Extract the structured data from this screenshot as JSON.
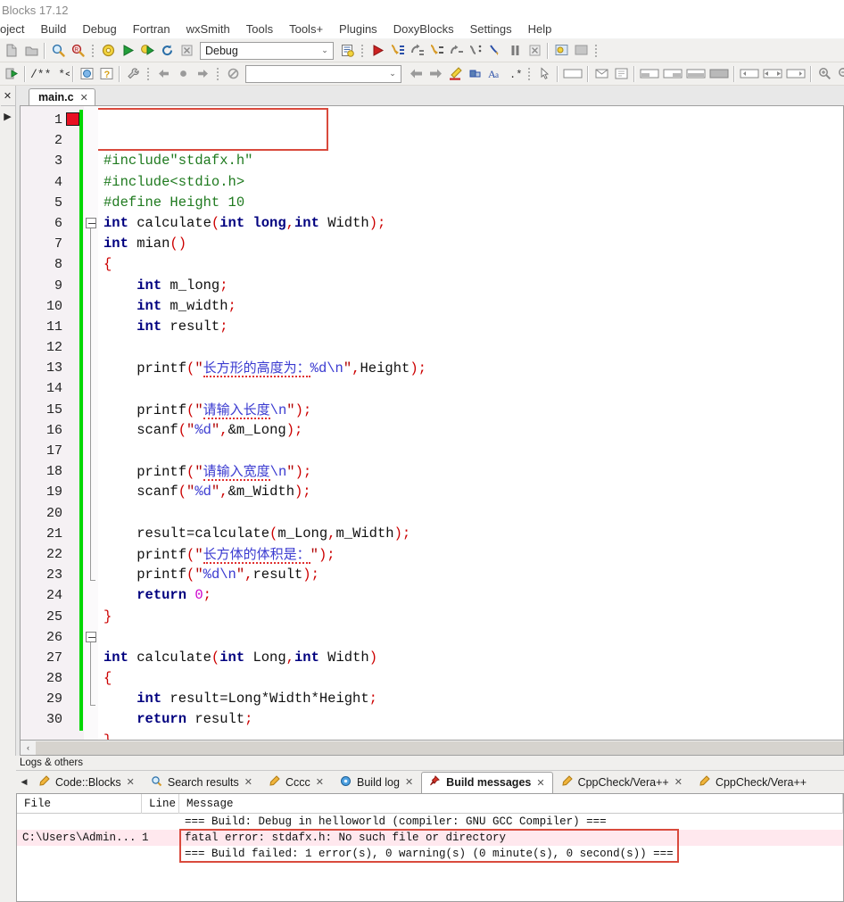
{
  "window": {
    "title": "Blocks 17.12"
  },
  "menubar": {
    "items": [
      {
        "label": "oject"
      },
      {
        "label": "Build"
      },
      {
        "label": "Debug"
      },
      {
        "label": "Fortran"
      },
      {
        "label": "wxSmith"
      },
      {
        "label": "Tools"
      },
      {
        "label": "Tools+"
      },
      {
        "label": "Plugins"
      },
      {
        "label": "DoxyBlocks"
      },
      {
        "label": "Settings"
      },
      {
        "label": "Help"
      }
    ]
  },
  "toolbar_main": {
    "target_combo": {
      "value": "Debug",
      "arrow": "⌄"
    },
    "icons": [
      "new-file-icon",
      "open-file-icon",
      "find-icon",
      "find-replace-icon",
      "build-icon",
      "run-icon",
      "build-and-run-icon",
      "rebuild-icon",
      "abort-build-icon",
      "build-target-options-icon",
      "debug-continue-icon",
      "debug-run-to-cursor-icon",
      "debug-next-line-icon",
      "debug-step-into-icon",
      "debug-step-out-icon",
      "debug-next-instruction-icon",
      "debug-step-into-instruction-icon",
      "debug-break-icon",
      "debug-stop-icon",
      "debugging-windows-icon",
      "various-info-icon"
    ]
  },
  "toolbar_secondary": {
    "blank_combo": {
      "value": "",
      "arrow": "⌄"
    },
    "icons": [
      "doxyblocks-run-icon",
      "doxyblocks-comment-icon",
      "doxyblocks-block-comment-icon",
      "doxyblocks-preview-icon",
      "doxyblocks-help-icon",
      "doxyblocks-config-icon",
      "goto-previous-icon",
      "bookmark-icon",
      "goto-next-icon",
      "clear-bookmarks-icon",
      "back-icon",
      "forward-icon",
      "highlight-icon",
      "replace-icon",
      "font-size-icon",
      "regex-icon",
      "pointer-icon",
      "panel-icon",
      "envelope-icon",
      "form-icon",
      "align-left-icon",
      "align-right-icon",
      "align-center-icon",
      "fill-icon",
      "expand-left-icon",
      "shrink-icon",
      "expand-right-icon",
      "zoom-in-icon",
      "zoom-out-icon"
    ]
  },
  "left_dock": {
    "close_label": "✕",
    "expand_label": "▶"
  },
  "editor": {
    "tab": {
      "label": "main.c",
      "close": "✕"
    },
    "breakpoint_line": 1,
    "fold_open_lines": [
      6,
      26
    ],
    "annotation_rect": {
      "note": "red box around include lines"
    },
    "hscroll": {
      "left_arrow": "‹"
    },
    "lines": [
      {
        "n": 1,
        "tokens": [
          {
            "t": "pre",
            "v": "#include\"stdafx.h\""
          }
        ]
      },
      {
        "n": 2,
        "tokens": [
          {
            "t": "pre",
            "v": "#include<stdio.h>"
          }
        ]
      },
      {
        "n": 3,
        "tokens": [
          {
            "t": "pre",
            "v": "#define Height 10"
          }
        ]
      },
      {
        "n": 4,
        "tokens": [
          {
            "t": "kw",
            "v": "int"
          },
          {
            "t": "id",
            "v": " calculate"
          },
          {
            "t": "pun",
            "v": "("
          },
          {
            "t": "kw",
            "v": "int"
          },
          {
            "t": "id",
            "v": " "
          },
          {
            "t": "kw",
            "v": "long"
          },
          {
            "t": "pun",
            "v": ","
          },
          {
            "t": "kw",
            "v": "int"
          },
          {
            "t": "id",
            "v": " Width"
          },
          {
            "t": "pun",
            "v": ");"
          }
        ]
      },
      {
        "n": 5,
        "tokens": [
          {
            "t": "kw",
            "v": "int"
          },
          {
            "t": "id",
            "v": " mian"
          },
          {
            "t": "pun",
            "v": "()"
          }
        ]
      },
      {
        "n": 6,
        "tokens": [
          {
            "t": "pun",
            "v": "{"
          }
        ]
      },
      {
        "n": 7,
        "tokens": [
          {
            "t": "id",
            "v": "    "
          },
          {
            "t": "kw",
            "v": "int"
          },
          {
            "t": "id",
            "v": " m_long"
          },
          {
            "t": "pun",
            "v": ";"
          }
        ]
      },
      {
        "n": 8,
        "tokens": [
          {
            "t": "id",
            "v": "    "
          },
          {
            "t": "kw",
            "v": "int"
          },
          {
            "t": "id",
            "v": " m_width"
          },
          {
            "t": "pun",
            "v": ";"
          }
        ]
      },
      {
        "n": 9,
        "tokens": [
          {
            "t": "id",
            "v": "    "
          },
          {
            "t": "kw",
            "v": "int"
          },
          {
            "t": "id",
            "v": " result"
          },
          {
            "t": "pun",
            "v": ";"
          }
        ]
      },
      {
        "n": 10,
        "tokens": []
      },
      {
        "n": 11,
        "tokens": [
          {
            "t": "id",
            "v": "    printf"
          },
          {
            "t": "pun",
            "v": "("
          },
          {
            "t": "qt",
            "v": "\""
          },
          {
            "t": "cjk",
            "v": "长方形的高度为："
          },
          {
            "t": "str",
            "v": "%d\\n"
          },
          {
            "t": "qt",
            "v": "\""
          },
          {
            "t": "pun",
            "v": ","
          },
          {
            "t": "id",
            "v": "Height"
          },
          {
            "t": "pun",
            "v": ");"
          }
        ]
      },
      {
        "n": 12,
        "tokens": []
      },
      {
        "n": 13,
        "tokens": [
          {
            "t": "id",
            "v": "    printf"
          },
          {
            "t": "pun",
            "v": "("
          },
          {
            "t": "qt",
            "v": "\""
          },
          {
            "t": "cjk",
            "v": "请输入长度"
          },
          {
            "t": "str",
            "v": "\\n"
          },
          {
            "t": "qt",
            "v": "\""
          },
          {
            "t": "pun",
            "v": ");"
          }
        ]
      },
      {
        "n": 14,
        "tokens": [
          {
            "t": "id",
            "v": "    scanf"
          },
          {
            "t": "pun",
            "v": "("
          },
          {
            "t": "qt",
            "v": "\""
          },
          {
            "t": "str",
            "v": "%d"
          },
          {
            "t": "qt",
            "v": "\""
          },
          {
            "t": "pun",
            "v": ","
          },
          {
            "t": "id",
            "v": "&m_Long"
          },
          {
            "t": "pun",
            "v": ");"
          }
        ]
      },
      {
        "n": 15,
        "tokens": []
      },
      {
        "n": 16,
        "tokens": [
          {
            "t": "id",
            "v": "    printf"
          },
          {
            "t": "pun",
            "v": "("
          },
          {
            "t": "qt",
            "v": "\""
          },
          {
            "t": "cjk",
            "v": "请输入宽度"
          },
          {
            "t": "str",
            "v": "\\n"
          },
          {
            "t": "qt",
            "v": "\""
          },
          {
            "t": "pun",
            "v": ");"
          }
        ]
      },
      {
        "n": 17,
        "tokens": [
          {
            "t": "id",
            "v": "    scanf"
          },
          {
            "t": "pun",
            "v": "("
          },
          {
            "t": "qt",
            "v": "\""
          },
          {
            "t": "str",
            "v": "%d"
          },
          {
            "t": "qt",
            "v": "\""
          },
          {
            "t": "pun",
            "v": ","
          },
          {
            "t": "id",
            "v": "&m_Width"
          },
          {
            "t": "pun",
            "v": ");"
          }
        ]
      },
      {
        "n": 18,
        "tokens": []
      },
      {
        "n": 19,
        "tokens": [
          {
            "t": "id",
            "v": "    result=calculate"
          },
          {
            "t": "pun",
            "v": "("
          },
          {
            "t": "id",
            "v": "m_Long"
          },
          {
            "t": "pun",
            "v": ","
          },
          {
            "t": "id",
            "v": "m_Width"
          },
          {
            "t": "pun",
            "v": ");"
          }
        ]
      },
      {
        "n": 20,
        "tokens": [
          {
            "t": "id",
            "v": "    printf"
          },
          {
            "t": "pun",
            "v": "("
          },
          {
            "t": "qt",
            "v": "\""
          },
          {
            "t": "cjk",
            "v": "长方体的体积是："
          },
          {
            "t": "qt",
            "v": "\""
          },
          {
            "t": "pun",
            "v": ");"
          }
        ]
      },
      {
        "n": 21,
        "tokens": [
          {
            "t": "id",
            "v": "    printf"
          },
          {
            "t": "pun",
            "v": "("
          },
          {
            "t": "qt",
            "v": "\""
          },
          {
            "t": "str",
            "v": "%d\\n"
          },
          {
            "t": "qt",
            "v": "\""
          },
          {
            "t": "pun",
            "v": ","
          },
          {
            "t": "id",
            "v": "result"
          },
          {
            "t": "pun",
            "v": ");"
          }
        ]
      },
      {
        "n": 22,
        "tokens": [
          {
            "t": "id",
            "v": "    "
          },
          {
            "t": "kw",
            "v": "return"
          },
          {
            "t": "num",
            "v": " 0"
          },
          {
            "t": "pun",
            "v": ";"
          }
        ]
      },
      {
        "n": 23,
        "tokens": [
          {
            "t": "pun",
            "v": "}"
          }
        ]
      },
      {
        "n": 24,
        "tokens": []
      },
      {
        "n": 25,
        "tokens": [
          {
            "t": "kw",
            "v": "int"
          },
          {
            "t": "id",
            "v": " calculate"
          },
          {
            "t": "pun",
            "v": "("
          },
          {
            "t": "kw",
            "v": "int"
          },
          {
            "t": "id",
            "v": " Long"
          },
          {
            "t": "pun",
            "v": ","
          },
          {
            "t": "kw",
            "v": "int"
          },
          {
            "t": "id",
            "v": " Width"
          },
          {
            "t": "pun",
            "v": ")"
          }
        ]
      },
      {
        "n": 26,
        "tokens": [
          {
            "t": "pun",
            "v": "{"
          }
        ]
      },
      {
        "n": 27,
        "tokens": [
          {
            "t": "id",
            "v": "    "
          },
          {
            "t": "kw",
            "v": "int"
          },
          {
            "t": "id",
            "v": " result=Long*Width*Height"
          },
          {
            "t": "pun",
            "v": ";"
          }
        ]
      },
      {
        "n": 28,
        "tokens": [
          {
            "t": "id",
            "v": "    "
          },
          {
            "t": "kw",
            "v": "return"
          },
          {
            "t": "id",
            "v": " result"
          },
          {
            "t": "pun",
            "v": ";"
          }
        ]
      },
      {
        "n": 29,
        "tokens": [
          {
            "t": "pun",
            "v": "}"
          }
        ]
      },
      {
        "n": 30,
        "tokens": []
      }
    ]
  },
  "logs": {
    "title": "Logs & others",
    "scroll_left": "◀",
    "tabs": [
      {
        "label": "Code::Blocks",
        "icon": "pencil-icon",
        "active": false,
        "close": "✕"
      },
      {
        "label": "Search results",
        "icon": "search-icon",
        "active": false,
        "close": "✕"
      },
      {
        "label": "Cccc",
        "icon": "pencil-icon",
        "active": false,
        "close": "✕"
      },
      {
        "label": "Build log",
        "icon": "gear-blue-icon",
        "active": false,
        "close": "✕"
      },
      {
        "label": "Build messages",
        "icon": "pin-icon",
        "active": true,
        "close": "✕"
      },
      {
        "label": "CppCheck/Vera++",
        "icon": "pencil-icon",
        "active": false,
        "close": "✕"
      },
      {
        "label": "CppCheck/Vera++",
        "icon": "pencil-icon",
        "active": false,
        "close": ""
      }
    ],
    "columns": [
      "File",
      "Line",
      "Message"
    ],
    "rows": [
      {
        "file": "",
        "line": "",
        "message": "=== Build: Debug in helloworld (compiler: GNU GCC Compiler) ===",
        "error": false
      },
      {
        "file": "C:\\Users\\Admin...",
        "line": "1",
        "message": "fatal error: stdafx.h: No such file or directory",
        "error": true
      },
      {
        "file": "",
        "line": "",
        "message": "=== Build failed: 1 error(s), 0 warning(s) (0 minute(s), 0 second(s)) ===",
        "error": false
      }
    ]
  },
  "colors": {
    "annotation_red": "#d94a3d",
    "breakpoint_red": "#e81123",
    "change_bar_green": "#00d700",
    "keyword": "#00007f",
    "preprocessor": "#1f7a1f",
    "string": "#3a3ad0",
    "punctuation": "#cc0000",
    "number": "#cc00cc",
    "error_row_bg": "#ffe8ee"
  }
}
